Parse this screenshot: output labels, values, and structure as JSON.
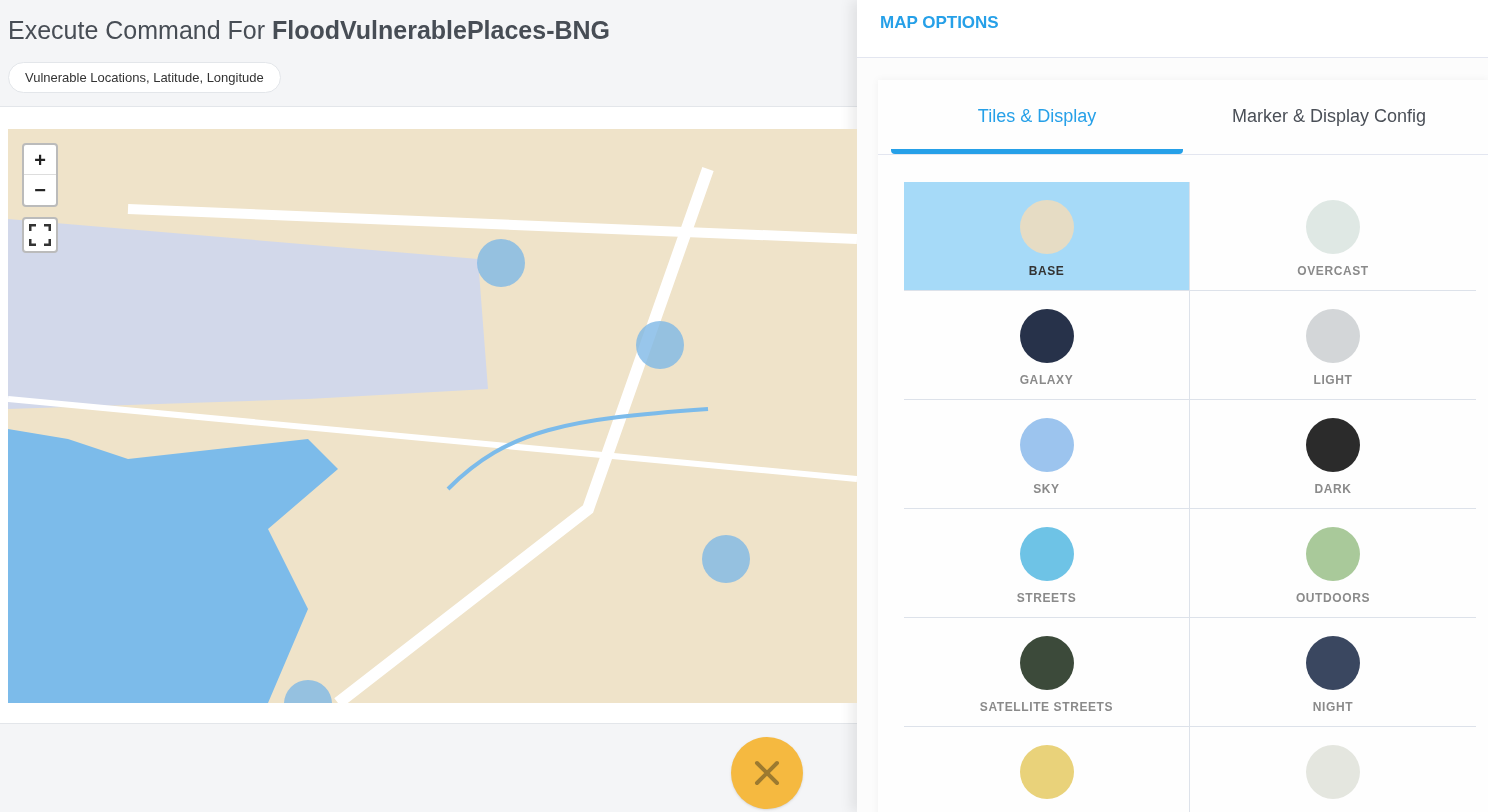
{
  "header": {
    "title_prefix": "Execute Command For",
    "title_name": "FloodVulnerablePlaces-BNG",
    "chip": "Vulnerable Locations, Latitude, Longitude"
  },
  "map": {
    "zoom_in": "+",
    "zoom_out": "−"
  },
  "panel": {
    "title": "MAP OPTIONS",
    "tabs": [
      {
        "label": "Tiles & Display",
        "selected": true
      },
      {
        "label": "Marker & Display Config",
        "selected": false
      }
    ],
    "tiles": [
      {
        "label": "BASE",
        "selected": true,
        "color": "#e6dcc4"
      },
      {
        "label": "OVERCAST",
        "selected": false,
        "color": "#dfe8e4"
      },
      {
        "label": "GALAXY",
        "selected": false,
        "color": "#27324a"
      },
      {
        "label": "LIGHT",
        "selected": false,
        "color": "#d3d6d8"
      },
      {
        "label": "SKY",
        "selected": false,
        "color": "#9cc4ee"
      },
      {
        "label": "DARK",
        "selected": false,
        "color": "#2b2b2b"
      },
      {
        "label": "STREETS",
        "selected": false,
        "color": "#6ec3e6"
      },
      {
        "label": "OUTDOORS",
        "selected": false,
        "color": "#a9c99a"
      },
      {
        "label": "SATELLITE STREETS",
        "selected": false,
        "color": "#3c4a3a"
      },
      {
        "label": "NIGHT",
        "selected": false,
        "color": "#3a4760"
      },
      {
        "selected": false,
        "color": "#e9d27a"
      },
      {
        "selected": false,
        "color": "#e4e6df"
      }
    ]
  }
}
